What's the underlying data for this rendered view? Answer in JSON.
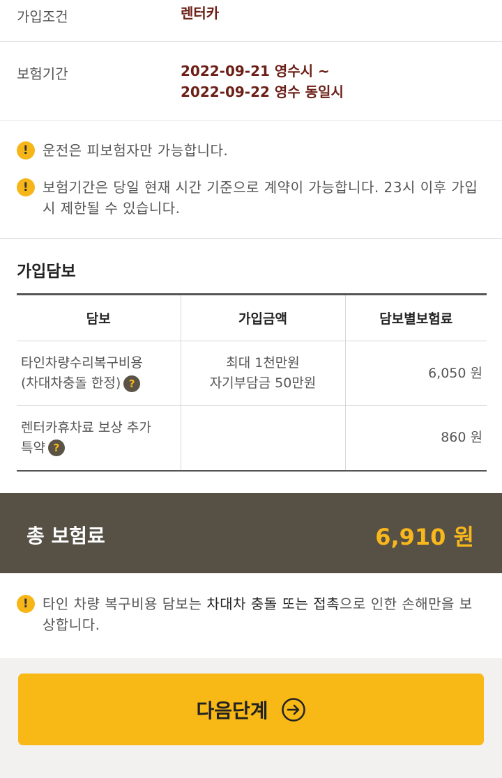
{
  "info": {
    "condition_label": "가입조건",
    "condition_value": "렌터카",
    "period_label": "보험기간",
    "period_line1": "2022-09-21 영수시 ~",
    "period_line2": "2022-09-22 영수 동일시"
  },
  "notices": {
    "n1": "운전은 피보험자만 가능합니다.",
    "n2": "보험기간은 당일 현재 시간 기준으로 계약이 가능합니다. 23시 이후 가입 시 제한될 수 있습니다."
  },
  "coverage": {
    "title": "가입담보",
    "headers": [
      "담보",
      "가입금액",
      "담보별보험료"
    ],
    "rows": [
      {
        "name_line1": "타인차량수리복구비용",
        "name_line2": "(차대차충돌 한정)",
        "amount_line1": "최대 1천만원",
        "amount_line2": "자기부담금 50만원",
        "premium": "6,050 원"
      },
      {
        "name_line1": "렌터카휴차료 보상 추가",
        "name_line2": "특약",
        "amount_line1": "",
        "amount_line2": "",
        "premium": "860 원"
      }
    ],
    "help_glyph": "?"
  },
  "total": {
    "label": "총 보험료",
    "value": "6,910 원"
  },
  "bottom_notice": {
    "part1": "타인 차량 복구비용 담보는 ",
    "highlight1": "차대차 충돌 또는 접촉",
    "part2": "으로 인한 손해만을 보상합니다."
  },
  "next_button": {
    "label": "다음단계",
    "icon": "arrow-right-circle-icon"
  },
  "icons": {
    "notice_glyph": "!"
  },
  "colors": {
    "accent": "#f8b816",
    "value_text": "#6b1f16",
    "total_bar": "#565045",
    "total_value": "#f8b81c"
  }
}
